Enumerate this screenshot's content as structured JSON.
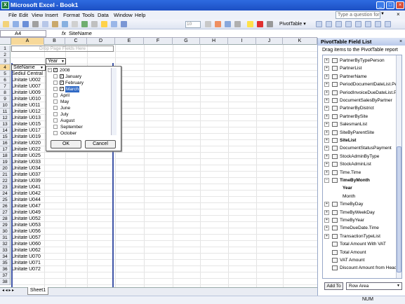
{
  "window": {
    "title": "Microsoft Excel - Book1",
    "app_icon": "X"
  },
  "menu": [
    "File",
    "Edit",
    "View",
    "Insert",
    "Format",
    "Tools",
    "Data",
    "Window",
    "Help"
  ],
  "help_placeholder": "Type a question for help",
  "toolbar": {
    "font_size": "10",
    "pivottable_label": "PivotTable ▾"
  },
  "formula_bar": {
    "name_box": "A4",
    "fx": "fx",
    "value": "SiteName"
  },
  "columns": [
    "A",
    "B",
    "C",
    "D",
    "E",
    "F",
    "G",
    "H",
    "I",
    "J",
    "K"
  ],
  "rows": [
    "1",
    "2",
    "3",
    "4",
    "5",
    "6",
    "7",
    "8",
    "9",
    "10",
    "11",
    "12",
    "13",
    "14",
    "15",
    "16",
    "17",
    "18",
    "19",
    "20",
    "21",
    "22",
    "23",
    "24",
    "25",
    "26",
    "27",
    "28",
    "29",
    "30",
    "31",
    "32",
    "33",
    "34",
    "35",
    "36",
    "37",
    "38"
  ],
  "grid": {
    "drop_page_fields": "Drop Page Fields Here",
    "year_header": "Year",
    "sitename_header": "SiteName",
    "site_names": [
      "Sediul Central",
      "Unitate U002",
      "Unitate U007",
      "Unitate U009",
      "Unitate U010",
      "Unitate U011",
      "Unitate U012",
      "Unitate U013",
      "Unitate U015",
      "Unitate U017",
      "Unitate U019",
      "Unitate U020",
      "Unitate U022",
      "Unitate U025",
      "Unitate U033",
      "Unitate U034",
      "Unitate U037",
      "Unitate U039",
      "Unitate U041",
      "Unitate U042",
      "Unitate U044",
      "Unitate U047",
      "Unitate U049",
      "Unitate U052",
      "Unitate U053",
      "Unitate U056",
      "Unitate U057",
      "Unitate U060",
      "Unitate U062",
      "Unitate U070",
      "Unitate U071",
      "Unitate U072"
    ]
  },
  "popup": {
    "root": "2008",
    "items": [
      {
        "label": "January",
        "checked": true
      },
      {
        "label": "February",
        "checked": true
      },
      {
        "label": "March",
        "checked": true
      },
      {
        "label": "April",
        "checked": false
      },
      {
        "label": "May",
        "checked": false
      },
      {
        "label": "June",
        "checked": false
      },
      {
        "label": "July",
        "checked": false
      },
      {
        "label": "August",
        "checked": false
      },
      {
        "label": "September",
        "checked": false
      },
      {
        "label": "October",
        "checked": false
      }
    ],
    "ok": "OK",
    "cancel": "Cancel"
  },
  "sheet_tab": "Sheet1",
  "status": "NUM",
  "panel": {
    "title": "PivotTable Field List",
    "close": "×",
    "instructions": "Drag items to the PivotTable report",
    "fields": [
      "PartnerByTypePerson",
      "PartnerList",
      "PartnerName",
      "PeriodDocumentDateList.Pe",
      "PeriodInvoiceDueDateList.Per",
      "DocumentSalesByPartner",
      "PartnerByDistrict",
      "PartnerBySite",
      "SalesmanList",
      "SiteByParentSite",
      "SiteList",
      "DocumentStatusPayment",
      "StockAdminByType",
      "StockAdminList",
      "Time.Time",
      "TimeByMonth",
      "Year",
      "Month",
      "TimeByDay",
      "TimeByWeekDay",
      "TimeByYear",
      "TimeDueDate.Time",
      "TransactionTypeList",
      "Total Amount With VAT",
      "Total Amount",
      "VAT Amount",
      "Discount Amount from Heade"
    ],
    "add_to": "Add To",
    "area": "Row Area"
  }
}
